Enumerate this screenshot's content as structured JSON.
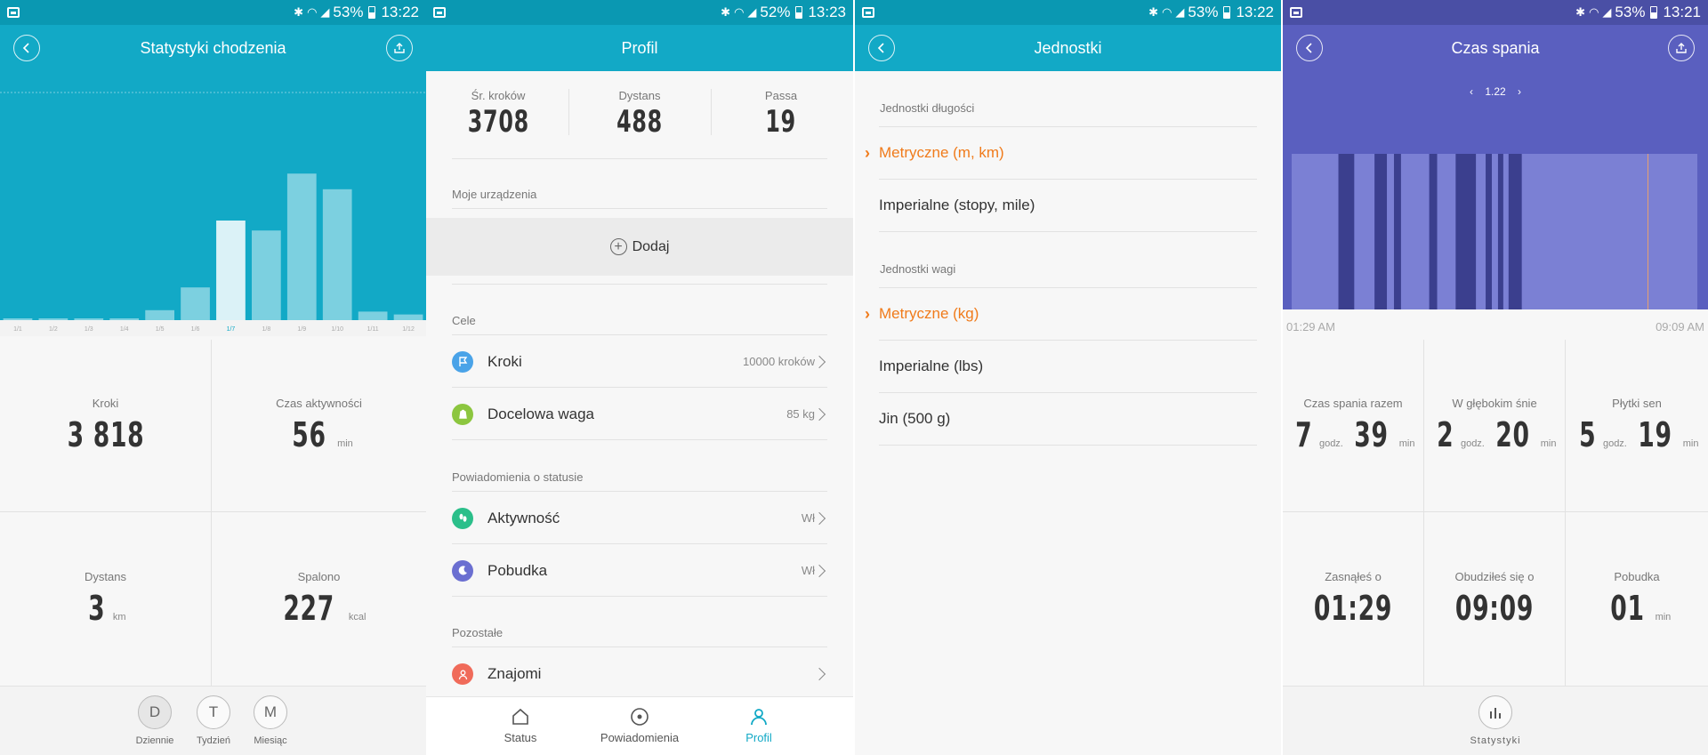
{
  "status_bars": [
    {
      "battery": "53%",
      "time": "13:22"
    },
    {
      "battery": "52%",
      "time": "13:23"
    },
    {
      "battery": "53%",
      "time": "13:22"
    },
    {
      "battery": "53%",
      "time": "13:21"
    }
  ],
  "walking": {
    "title": "Statystyki chodzenia",
    "chart_data": {
      "type": "bar",
      "categories": [
        "1/1",
        "1/2",
        "1/3",
        "1/4",
        "1/5",
        "1/6",
        "1/7",
        "1/8",
        "1/9",
        "1/10",
        "1/11",
        "1/12"
      ],
      "values": [
        0,
        0,
        0,
        0,
        700,
        2300,
        7000,
        6300,
        10300,
        9200,
        600,
        400
      ],
      "selected": "1/7",
      "grid_y": 16000,
      "ylim": [
        0,
        17500
      ]
    },
    "stats": {
      "steps_label": "Kroki",
      "steps_value": "3 818",
      "active_label": "Czas aktywności",
      "active_value": "56",
      "active_unit": "min",
      "distance_label": "Dystans",
      "distance_value": "3",
      "distance_unit": "km",
      "burned_label": "Spalono",
      "burned_value": "227",
      "burned_unit": "kcal"
    },
    "range_tabs": [
      {
        "letter": "D",
        "label": "Dziennie",
        "active": true
      },
      {
        "letter": "T",
        "label": "Tydzień",
        "active": false
      },
      {
        "letter": "M",
        "label": "Miesiąc",
        "active": false
      }
    ]
  },
  "profile": {
    "title": "Profil",
    "summary": [
      {
        "label": "Śr. kroków",
        "value": "3708"
      },
      {
        "label": "Dystans",
        "value": "488"
      },
      {
        "label": "Passa",
        "value": "19"
      }
    ],
    "devices_section": "Moje urządzenia",
    "add_label": "Dodaj",
    "goals_section": "Cele",
    "goals": [
      {
        "label": "Kroki",
        "value": "10000 kroków",
        "color": "#4aa3e8",
        "icon": "flag-icon"
      },
      {
        "label": "Docelowa waga",
        "value": "85 kg",
        "color": "#8cc63f",
        "icon": "weight-icon"
      }
    ],
    "notifications_section": "Powiadomienia o statusie",
    "notifications": [
      {
        "label": "Aktywność",
        "value": "Wł",
        "color": "#2bbf8a",
        "icon": "footsteps-icon"
      },
      {
        "label": "Pobudka",
        "value": "Wł",
        "color": "#6b6fd1",
        "icon": "moon-icon"
      }
    ],
    "other_section": "Pozostałe",
    "other": [
      {
        "label": "Znajomi",
        "value": "",
        "color": "#f06b5a",
        "icon": "friends-icon"
      }
    ],
    "nav": [
      {
        "label": "Status",
        "active": false
      },
      {
        "label": "Powiadomienia",
        "active": false
      },
      {
        "label": "Profil",
        "active": true
      }
    ],
    "accent": "#12a9c6"
  },
  "units": {
    "title": "Jednostki",
    "length_section": "Jednostki długości",
    "length_options": [
      {
        "label": "Metryczne (m, km)",
        "selected": true
      },
      {
        "label": "Imperialne (stopy, mile)",
        "selected": false
      }
    ],
    "weight_section": "Jednostki wagi",
    "weight_options": [
      {
        "label": "Metryczne (kg)",
        "selected": true
      },
      {
        "label": "Imperialne (lbs)",
        "selected": false
      },
      {
        "label": "Jin (500 g)",
        "selected": false
      }
    ],
    "selected_color": "#f07b1b"
  },
  "sleep": {
    "title": "Czas spania",
    "date": "1.22",
    "start_time": "01:29 AM",
    "end_time": "09:09 AM",
    "chart_data": {
      "type": "timeline",
      "start": "01:29",
      "end": "09:09",
      "segments": [
        {
          "stage": "light",
          "from": "01:29",
          "to": "02:22"
        },
        {
          "stage": "deep",
          "from": "02:22",
          "to": "02:40"
        },
        {
          "stage": "light",
          "from": "02:40",
          "to": "03:03"
        },
        {
          "stage": "deep",
          "from": "03:03",
          "to": "03:17"
        },
        {
          "stage": "light",
          "from": "03:17",
          "to": "03:25"
        },
        {
          "stage": "deep",
          "from": "03:25",
          "to": "03:33"
        },
        {
          "stage": "light",
          "from": "03:33",
          "to": "04:05"
        },
        {
          "stage": "deep",
          "from": "04:05",
          "to": "04:14"
        },
        {
          "stage": "light",
          "from": "04:14",
          "to": "04:35"
        },
        {
          "stage": "deep",
          "from": "04:35",
          "to": "04:58"
        },
        {
          "stage": "light",
          "from": "04:58",
          "to": "05:09"
        },
        {
          "stage": "deep",
          "from": "05:09",
          "to": "05:16"
        },
        {
          "stage": "light",
          "from": "05:16",
          "to": "05:23"
        },
        {
          "stage": "deep",
          "from": "05:23",
          "to": "05:29"
        },
        {
          "stage": "light",
          "from": "05:29",
          "to": "05:35"
        },
        {
          "stage": "deep",
          "from": "05:35",
          "to": "05:50"
        },
        {
          "stage": "light",
          "from": "05:50",
          "to": "09:09"
        }
      ],
      "wake_marker": "08:13"
    },
    "colors": {
      "light": "#7b80d4",
      "deep": "#3b3f8e",
      "marker": "#e8a070"
    },
    "stats": {
      "total_label": "Czas spania razem",
      "total_h": "7",
      "total_m": "39",
      "deep_label": "W głębokim śnie",
      "deep_h": "2",
      "deep_m": "20",
      "light_label": "Płytki sen",
      "light_h": "5",
      "light_m": "19",
      "hours_unit": "godz.",
      "min_unit": "min",
      "fell_label": "Zasnąłeś o",
      "fell_value": "01:29",
      "woke_label": "Obudziłeś się o",
      "woke_value": "09:09",
      "wakeups_label": "Pobudka",
      "wakeups_value": "01",
      "wakeups_unit": "min"
    },
    "bottom_label": "Statystyki"
  }
}
